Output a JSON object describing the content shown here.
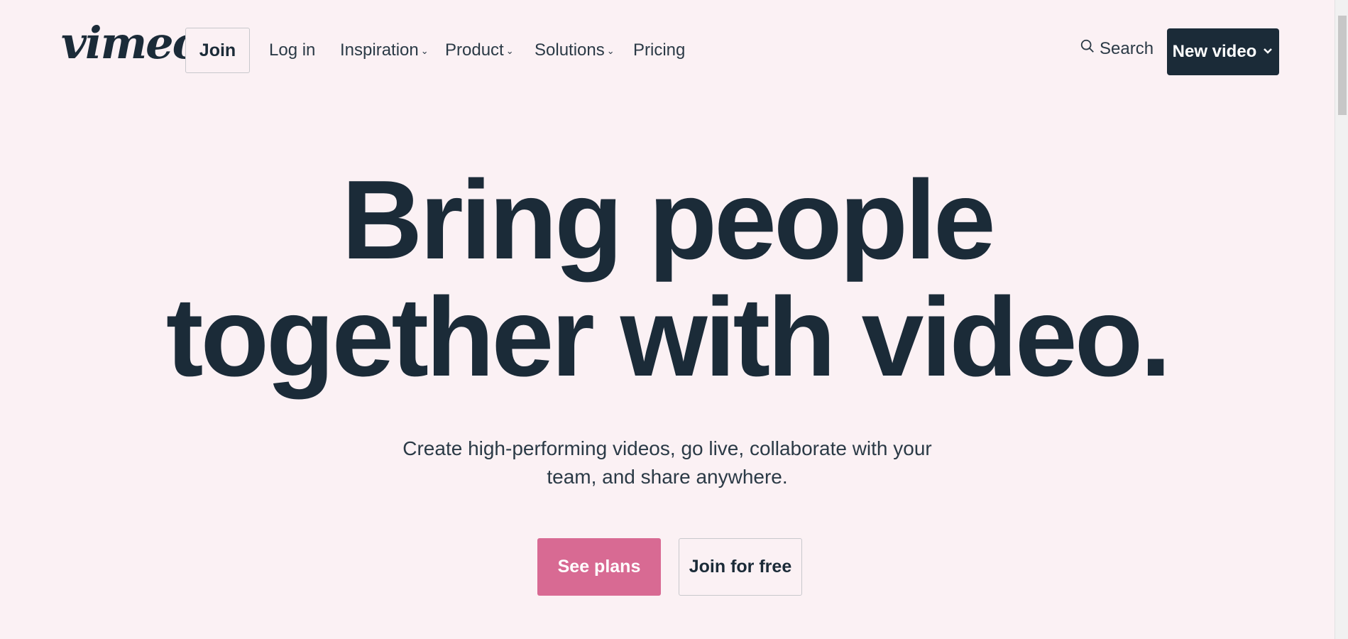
{
  "header": {
    "logo_text": "vimeo",
    "join_label": "Join",
    "login_label": "Log in",
    "nav": {
      "inspiration": "Inspiration",
      "product": "Product",
      "solutions": "Solutions",
      "pricing": "Pricing"
    },
    "search_label": "Search",
    "new_video_label": "New video"
  },
  "hero": {
    "title_line1": "Bring people",
    "title_line2": "together with video.",
    "subtitle_line1": "Create high-performing videos, go live, collaborate with your",
    "subtitle_line2": "team, and share anywhere.",
    "see_plans_label": "See plans",
    "join_free_label": "Join for free"
  },
  "colors": {
    "background": "#fbf1f4",
    "text_dark": "#1b2b38",
    "accent_pink": "#d86a93",
    "button_dark": "#1b2b38"
  },
  "icons": {
    "search": "search-icon",
    "chevron": "chevron-down-icon"
  }
}
